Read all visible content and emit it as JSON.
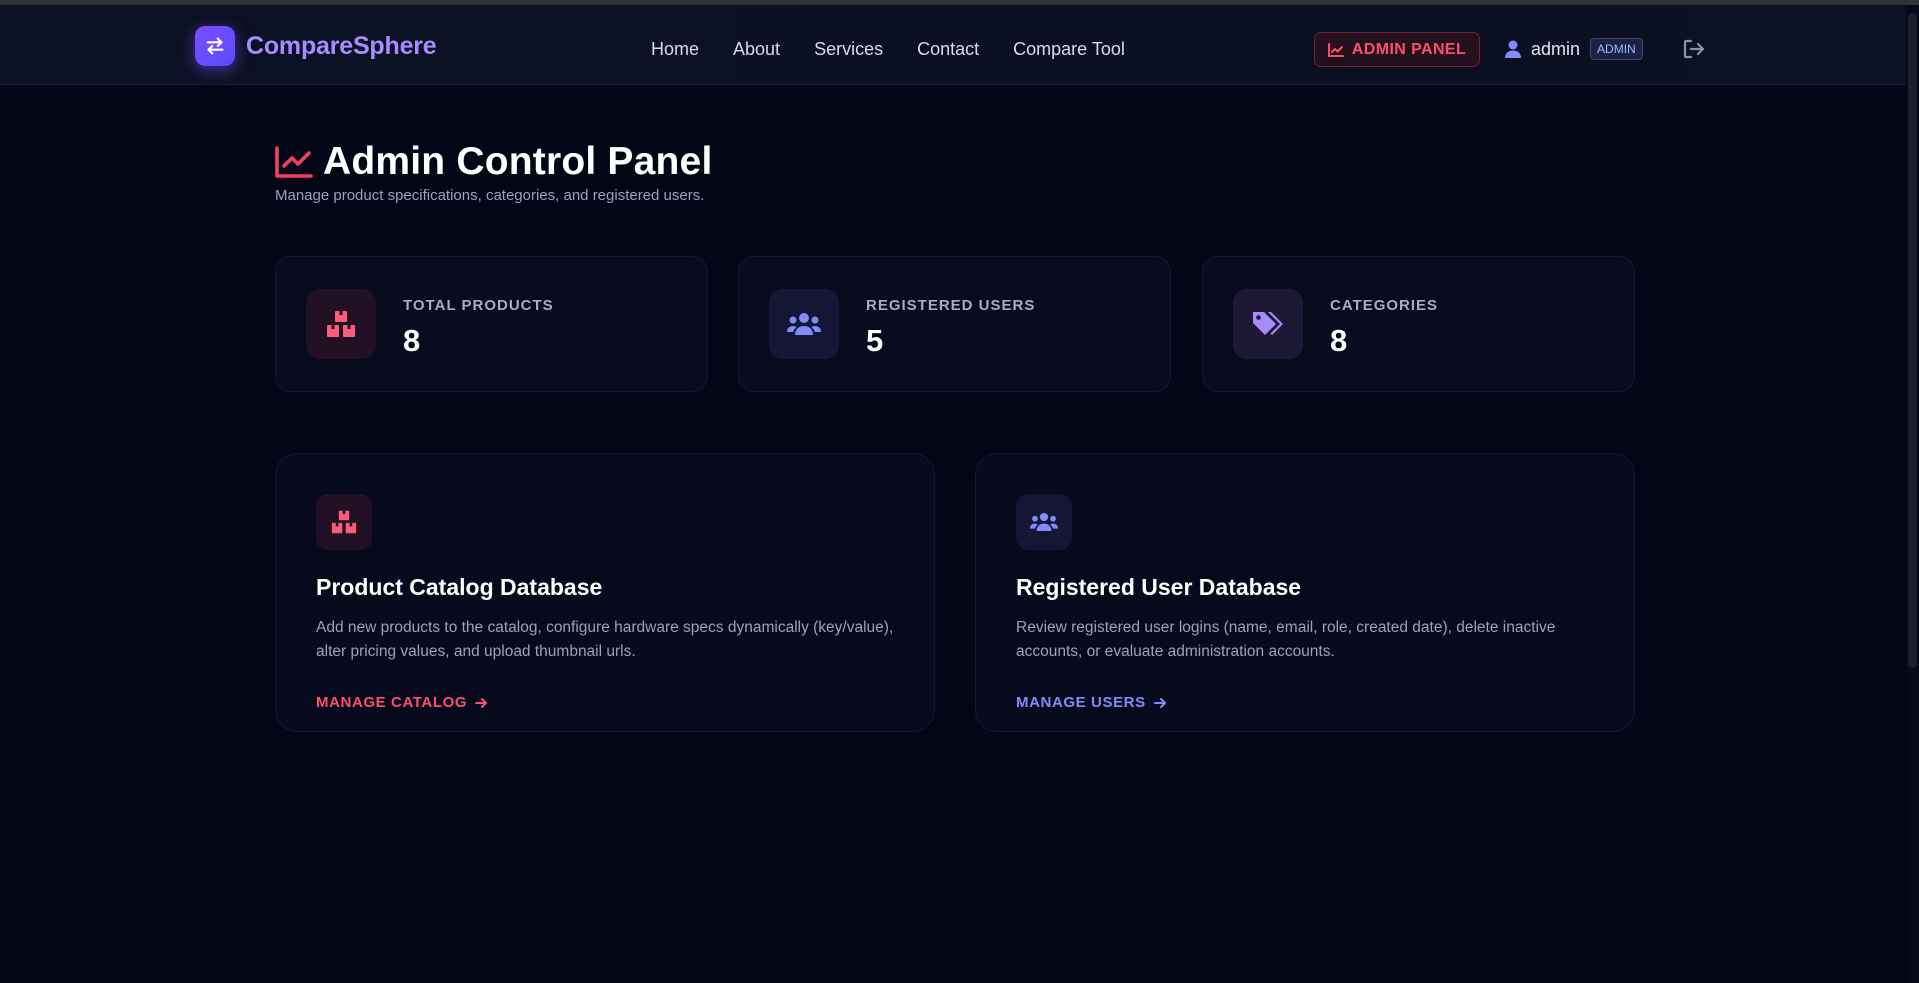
{
  "brand": {
    "name": "CompareSphere",
    "logo_icon": "swap-arrows-icon"
  },
  "nav": {
    "links": [
      {
        "label": "Home"
      },
      {
        "label": "About"
      },
      {
        "label": "Services"
      },
      {
        "label": "Contact"
      },
      {
        "label": "Compare Tool"
      }
    ],
    "admin_panel_label": "ADMIN PANEL",
    "user_name": "admin",
    "role_badge": "ADMIN"
  },
  "header": {
    "title": "Admin Control Panel",
    "subtitle": "Manage product specifications, categories, and registered users."
  },
  "stats": [
    {
      "label": "TOTAL PRODUCTS",
      "value": "8",
      "icon": "boxes-icon"
    },
    {
      "label": "REGISTERED USERS",
      "value": "5",
      "icon": "users-icon"
    },
    {
      "label": "CATEGORIES",
      "value": "8",
      "icon": "tags-icon"
    }
  ],
  "features": [
    {
      "title": "Product Catalog Database",
      "description": "Add new products to the catalog, configure hardware specs dynamically (key/value), alter pricing values, and upload thumbnail urls.",
      "link": "MANAGE CATALOG",
      "icon": "boxes-icon"
    },
    {
      "title": "Registered User Database",
      "description": "Review registered user logins (name, email, role, created date), delete inactive accounts, or evaluate administration accounts.",
      "link": "MANAGE USERS",
      "icon": "users-icon"
    }
  ],
  "colors": {
    "background": "#030617",
    "accent_red": "#fb4f6f",
    "accent_indigo": "#818cf8",
    "accent_purple": "#a78bfa",
    "brand_purple": "#a88bff"
  }
}
